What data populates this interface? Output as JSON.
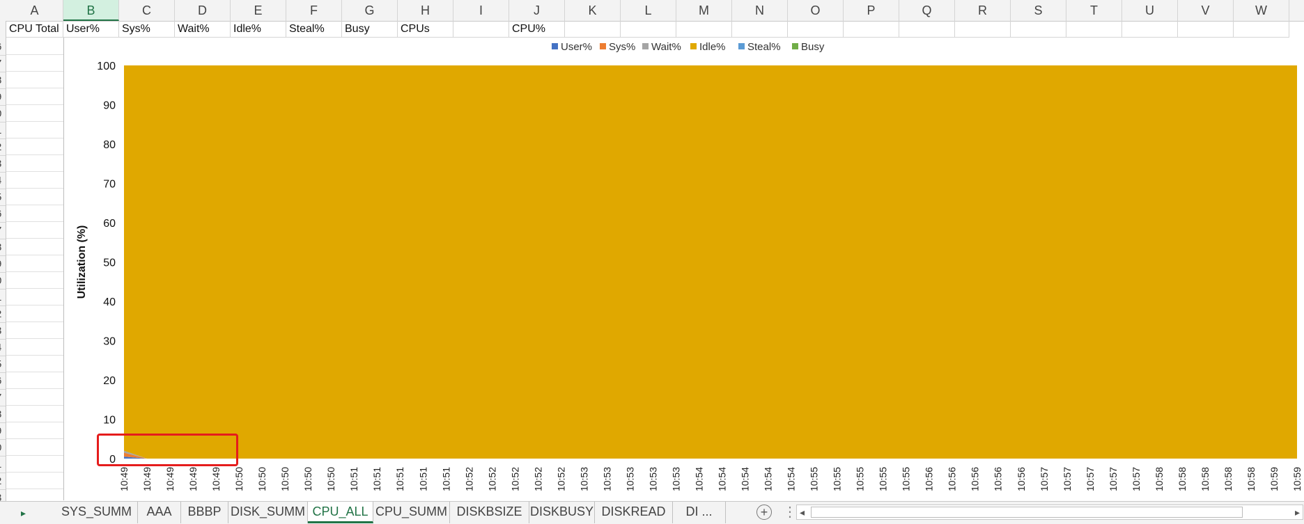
{
  "columns": [
    "A",
    "B",
    "C",
    "D",
    "E",
    "F",
    "G",
    "H",
    "I",
    "J",
    "K",
    "L",
    "M",
    "N",
    "O",
    "P",
    "Q",
    "R",
    "S",
    "T",
    "U",
    "V",
    "W"
  ],
  "selected_column": "B",
  "row_numbers": [
    "6",
    "7",
    "8",
    "9",
    "0",
    "1",
    "2",
    "3",
    "4",
    "5",
    "6",
    "7",
    "8",
    "9",
    "0",
    "1",
    "2",
    "3",
    "4",
    "5",
    "6",
    "7",
    "8",
    "9",
    "0",
    "1",
    "2",
    "3",
    "4"
  ],
  "row1": {
    "A": "CPU Total",
    "B": "User%",
    "C": "Sys%",
    "D": "Wait%",
    "E": "Idle%",
    "F": "Steal%",
    "G": "Busy",
    "H": "CPUs",
    "I": "",
    "J": "CPU%"
  },
  "chart_data": {
    "type": "area",
    "stacked": true,
    "title": "",
    "xlabel": "",
    "ylabel": "Utilization (%)",
    "ylim": [
      0,
      100
    ],
    "yticks": [
      0,
      10,
      20,
      30,
      40,
      50,
      60,
      70,
      80,
      90,
      100
    ],
    "legend_placement": "top",
    "x": [
      "10:49",
      "10:49",
      "10:49",
      "10:49",
      "10:49",
      "10:50",
      "10:50",
      "10:50",
      "10:50",
      "10:50",
      "10:51",
      "10:51",
      "10:51",
      "10:51",
      "10:51",
      "10:52",
      "10:52",
      "10:52",
      "10:52",
      "10:52",
      "10:53",
      "10:53",
      "10:53",
      "10:53",
      "10:53",
      "10:54",
      "10:54",
      "10:54",
      "10:54",
      "10:54",
      "10:55",
      "10:55",
      "10:55",
      "10:55",
      "10:55",
      "10:56",
      "10:56",
      "10:56",
      "10:56",
      "10:56",
      "10:57",
      "10:57",
      "10:57",
      "10:57",
      "10:57",
      "10:58",
      "10:58",
      "10:58",
      "10:58",
      "10:58",
      "10:59",
      "10:59"
    ],
    "series": [
      {
        "name": "User%",
        "color": "#4472c4",
        "values": [
          0.5,
          0,
          0,
          0,
          0,
          0,
          0,
          0,
          0,
          0,
          0,
          0,
          0,
          0,
          0,
          0,
          0,
          0,
          0,
          0,
          0,
          0,
          0,
          0,
          0,
          0,
          0,
          0,
          0,
          0,
          0,
          0,
          0,
          0,
          0,
          0,
          0,
          0,
          0,
          0,
          0,
          0,
          0,
          0,
          0,
          0,
          0,
          0,
          0,
          0,
          0,
          0
        ]
      },
      {
        "name": "Sys%",
        "color": "#ed7d31",
        "values": [
          1,
          0,
          0,
          0,
          0,
          0,
          0,
          0,
          0,
          0,
          0,
          0,
          0,
          0,
          0,
          0,
          0,
          0,
          0,
          0,
          0,
          0,
          0,
          0,
          0,
          0,
          0,
          0,
          0,
          0,
          0,
          0,
          0,
          0,
          0,
          0,
          0,
          0,
          0,
          0,
          0,
          0,
          0,
          0,
          0,
          0,
          0,
          0,
          0,
          0,
          0,
          0
        ]
      },
      {
        "name": "Wait%",
        "color": "#a5a5a5",
        "values": [
          0.5,
          0,
          0,
          0,
          0,
          0,
          0,
          0,
          0,
          0,
          0,
          0,
          0,
          0,
          0,
          0,
          0,
          0,
          0,
          0,
          0,
          0,
          0,
          0,
          0,
          0,
          0,
          0,
          0,
          0,
          0,
          0,
          0,
          0,
          0,
          0,
          0,
          0,
          0,
          0,
          0,
          0,
          0,
          0,
          0,
          0,
          0,
          0,
          0,
          0,
          0,
          0
        ]
      },
      {
        "name": "Idle%",
        "color": "#e0a800",
        "values": [
          98,
          100,
          100,
          100,
          100,
          100,
          100,
          100,
          100,
          100,
          100,
          100,
          100,
          100,
          100,
          100,
          100,
          100,
          100,
          100,
          100,
          100,
          100,
          100,
          100,
          100,
          100,
          100,
          100,
          100,
          100,
          100,
          100,
          100,
          100,
          100,
          100,
          100,
          100,
          100,
          100,
          100,
          100,
          100,
          100,
          100,
          100,
          100,
          100,
          100,
          100,
          100
        ]
      },
      {
        "name": "Steal%",
        "color": "#5b9bd5",
        "values": [
          0,
          0,
          0,
          0,
          0,
          0,
          0,
          0,
          0,
          0,
          0,
          0,
          0,
          0,
          0,
          0,
          0,
          0,
          0,
          0,
          0,
          0,
          0,
          0,
          0,
          0,
          0,
          0,
          0,
          0,
          0,
          0,
          0,
          0,
          0,
          0,
          0,
          0,
          0,
          0,
          0,
          0,
          0,
          0,
          0,
          0,
          0,
          0,
          0,
          0,
          0,
          0
        ]
      },
      {
        "name": "Busy",
        "color": "#70ad47",
        "values": [
          0,
          0,
          0,
          0,
          0,
          0,
          0,
          0,
          0,
          0,
          0,
          0,
          0,
          0,
          0,
          0,
          0,
          0,
          0,
          0,
          0,
          0,
          0,
          0,
          0,
          0,
          0,
          0,
          0,
          0,
          0,
          0,
          0,
          0,
          0,
          0,
          0,
          0,
          0,
          0,
          0,
          0,
          0,
          0,
          0,
          0,
          0,
          0,
          0,
          0,
          0,
          0
        ]
      }
    ]
  },
  "tabs": [
    "SYS_SUMM",
    "AAA",
    "BBBP",
    "DISK_SUMM",
    "CPU_ALL",
    "CPU_SUMM",
    "DISKBSIZE",
    "DISKBUSY",
    "DISKREAD",
    "DI ..."
  ],
  "active_tab": "CPU_ALL",
  "icons": {
    "tab_scroll": "triangle-right-icon",
    "add_sheet": "plus-circle-icon",
    "more": "vertical-dots-icon",
    "scroll_left": "triangle-left-icon",
    "scroll_right": "triangle-right-icon"
  },
  "glyphs": {
    "tab_scroll": "▸",
    "add_sheet": "+",
    "more": "⋮",
    "scroll_left": "◂",
    "scroll_right": "▸"
  },
  "colors": {
    "excel_green": "#217346",
    "highlight_box": "#e51c1c"
  }
}
